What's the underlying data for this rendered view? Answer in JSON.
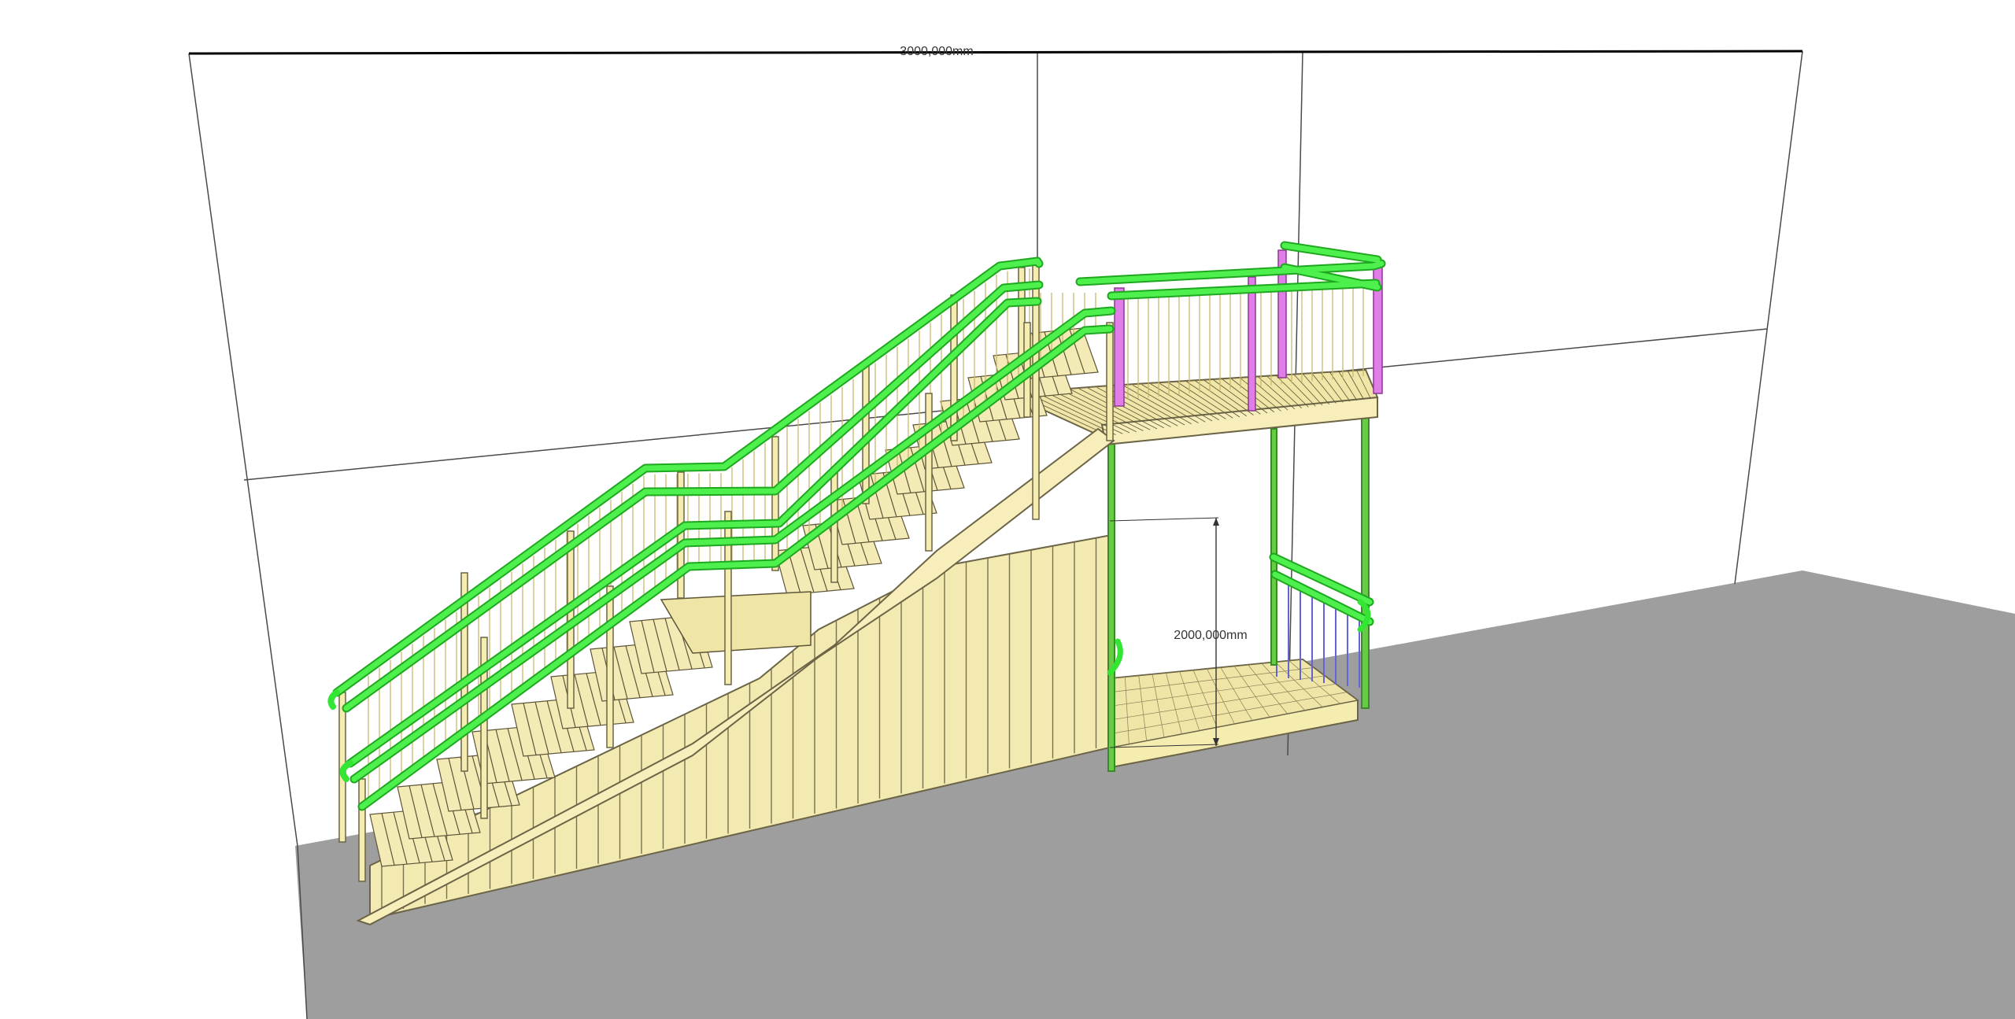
{
  "dimensions": {
    "top_width_label": "3000,000mm",
    "clearance_height_label": "2000,000mm"
  },
  "colors": {
    "background": "#ffffff",
    "floor": "#9e9e9e",
    "wall_lines": "#4a4a4a",
    "structure_fill": "#f5ecb0",
    "structure_stroke": "#6b6446",
    "handrail": "#33e633",
    "handrail_dark": "#1fa81f",
    "post_accent": "#e07de8",
    "infill_accent": "#6464d6",
    "support_column": "#66cc44"
  },
  "model": {
    "flights": 2,
    "lower_flight_steps": 7,
    "upper_flight_steps": 10,
    "landings": [
      "mid-landing",
      "top-landing",
      "lower-platform"
    ],
    "cladding": "vertical-profile-panels"
  }
}
